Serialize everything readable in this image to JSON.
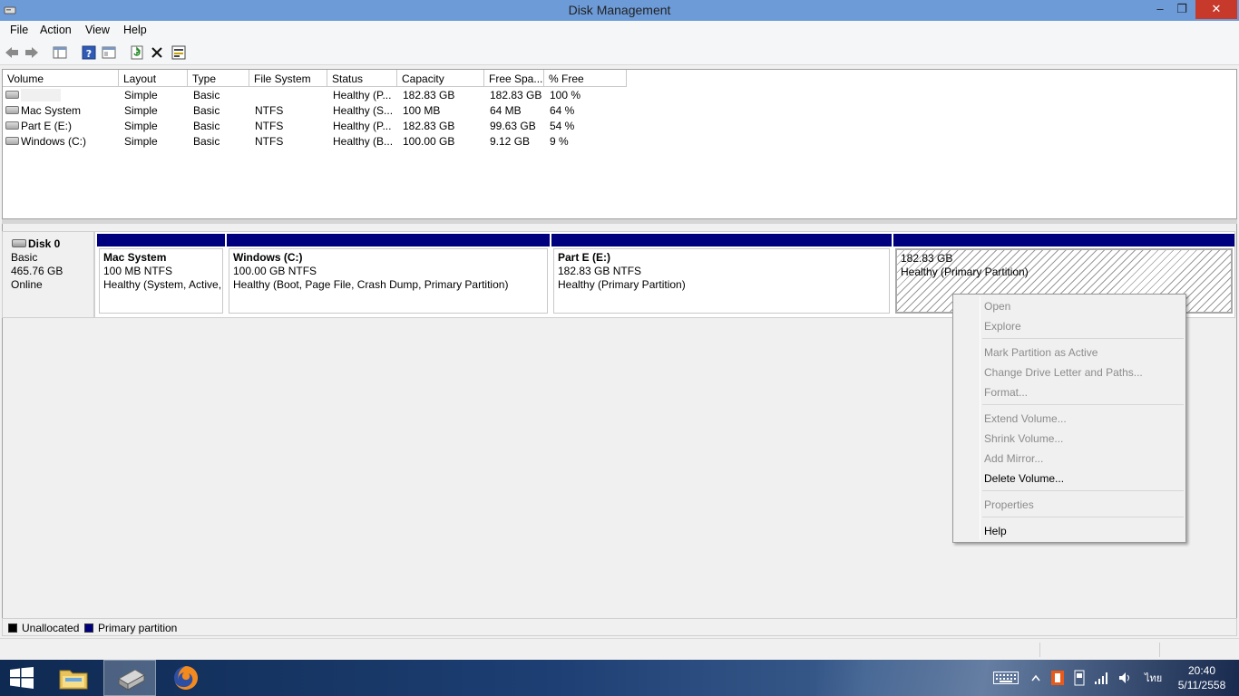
{
  "window": {
    "title": "Disk Management",
    "min_glyph": "–",
    "max_glyph": "❐",
    "close_glyph": "✕"
  },
  "menu": {
    "items": [
      "File",
      "Action",
      "View",
      "Help"
    ]
  },
  "toolbar": {
    "icons": [
      "back-arrow-icon",
      "forward-arrow-icon",
      "console-tree-icon",
      "help-icon",
      "properties-pane-icon",
      "refresh-icon",
      "delete-icon",
      "wizard-icon"
    ]
  },
  "volume_list": {
    "columns": [
      "Volume",
      "Layout",
      "Type",
      "File System",
      "Status",
      "Capacity",
      "Free Spa...",
      "% Free"
    ],
    "rows": [
      {
        "volume": "",
        "layout": "Simple",
        "type": "Basic",
        "fs": "",
        "status": "Healthy (P...",
        "capacity": "182.83 GB",
        "free": "182.83 GB",
        "pct": "100 %"
      },
      {
        "volume": "Mac System",
        "layout": "Simple",
        "type": "Basic",
        "fs": "NTFS",
        "status": "Healthy (S...",
        "capacity": "100 MB",
        "free": "64 MB",
        "pct": "64 %"
      },
      {
        "volume": "Part E (E:)",
        "layout": "Simple",
        "type": "Basic",
        "fs": "NTFS",
        "status": "Healthy (P...",
        "capacity": "182.83 GB",
        "free": "99.63 GB",
        "pct": "54 %"
      },
      {
        "volume": "Windows  (C:)",
        "layout": "Simple",
        "type": "Basic",
        "fs": "NTFS",
        "status": "Healthy (B...",
        "capacity": "100.00 GB",
        "free": "9.12 GB",
        "pct": "9 %"
      }
    ]
  },
  "disk": {
    "name": "Disk 0",
    "type": "Basic",
    "size": "465.76 GB",
    "state": "Online",
    "partitions": [
      {
        "name": "Mac System",
        "size": "100 MB NTFS",
        "status": "Healthy (System, Active,"
      },
      {
        "name": "Windows   (C:)",
        "size": "100.00 GB NTFS",
        "status": "Healthy (Boot, Page File, Crash Dump, Primary Partition)"
      },
      {
        "name": "Part E  (E:)",
        "size": "182.83 GB NTFS",
        "status": "Healthy (Primary Partition)"
      },
      {
        "name": "",
        "size": "182.83 GB",
        "status": "Healthy (Primary Partition)"
      }
    ]
  },
  "legend": {
    "unallocated_label": "Unallocated",
    "unallocated_color": "#000000",
    "primary_label": "Primary partition",
    "primary_color": "#00007f"
  },
  "context_menu": {
    "items": [
      {
        "label": "Open",
        "enabled": false
      },
      {
        "label": "Explore",
        "enabled": false
      },
      {
        "label": "Mark Partition as Active",
        "enabled": false
      },
      {
        "label": "Change Drive Letter and Paths...",
        "enabled": false
      },
      {
        "label": "Format...",
        "enabled": false
      },
      {
        "label": "Extend Volume...",
        "enabled": false
      },
      {
        "label": "Shrink Volume...",
        "enabled": false
      },
      {
        "label": "Add Mirror...",
        "enabled": false
      },
      {
        "label": "Delete Volume...",
        "enabled": true
      },
      {
        "label": "Properties",
        "enabled": false
      },
      {
        "label": "Help",
        "enabled": true
      }
    ]
  },
  "taskbar": {
    "apps": [
      "start-icon",
      "file-explorer-icon",
      "disk-management-icon",
      "firefox-icon"
    ],
    "tray": {
      "language": "ไทย",
      "time": "20:40",
      "date": "5/11/2558"
    }
  }
}
